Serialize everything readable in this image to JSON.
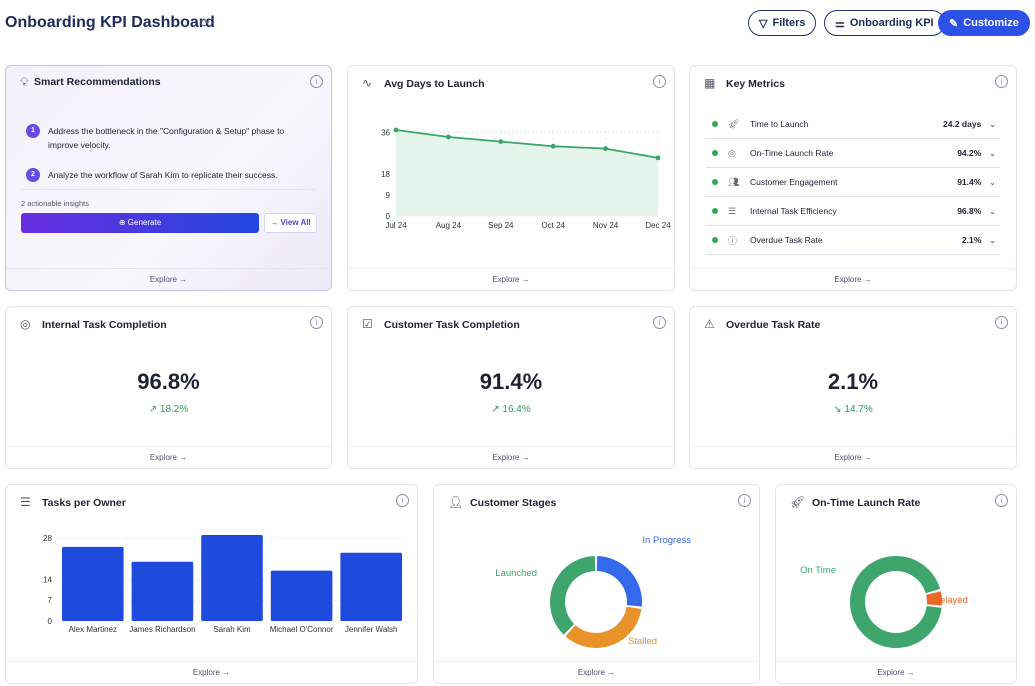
{
  "header": {
    "title": "Onboarding KPI Dashboard",
    "filters": "Filters",
    "kpi": "Onboarding KPI",
    "customize": "Customize"
  },
  "explore": "Explore →",
  "smart": {
    "title": "Smart Recommendations",
    "items": [
      {
        "n": "1",
        "text": "Address the bottleneck in the \"Configuration & Setup\" phase to improve velocity."
      },
      {
        "n": "2",
        "text": "Analyze the workflow of Sarah Kim to replicate their success."
      }
    ],
    "count": "2 actionable insights",
    "generate": "Generate",
    "view_all": "→ View All"
  },
  "avg": {
    "title": "Avg Days to Launch"
  },
  "key": {
    "title": "Key Metrics",
    "rows": [
      {
        "label": "Time to Launch",
        "value": "24.2 days"
      },
      {
        "label": "On-Time Launch Rate",
        "value": "94.2%"
      },
      {
        "label": "Customer Engagement",
        "value": "91.4%"
      },
      {
        "label": "Internal Task Efficiency",
        "value": "96.8%"
      },
      {
        "label": "Overdue Task Rate",
        "value": "2.1%"
      }
    ]
  },
  "kpis": [
    {
      "title": "Internal Task Completion",
      "value": "96.8%",
      "trend": "18.2%",
      "dir": "up"
    },
    {
      "title": "Customer Task Completion",
      "value": "91.4%",
      "trend": "16.4%",
      "dir": "up"
    },
    {
      "title": "Overdue Task Rate",
      "value": "2.1%",
      "trend": "14.7%",
      "dir": "down"
    }
  ],
  "tasks": {
    "title": "Tasks per Owner"
  },
  "stages": {
    "title": "Customer Stages"
  },
  "ontime": {
    "title": "On-Time Launch Rate"
  },
  "chart_data": [
    {
      "type": "line",
      "title": "Avg Days to Launch",
      "categories": [
        "Jul 24",
        "Aug 24",
        "Sep 24",
        "Oct 24",
        "Nov 24",
        "Dec 24"
      ],
      "values": [
        37,
        34,
        32,
        30,
        29,
        25
      ],
      "yticks": [
        0,
        9,
        18,
        36
      ],
      "ylim": [
        0,
        37
      ],
      "color": "#3aa56a"
    },
    {
      "type": "bar",
      "title": "Tasks per Owner",
      "categories": [
        "Alex Martinez",
        "James Richardson",
        "Sarah Kim",
        "Michael O'Connor",
        "Jennifer Walsh"
      ],
      "values": [
        25,
        20,
        29,
        17,
        23
      ],
      "yticks": [
        0,
        7,
        14,
        28
      ],
      "ylim": [
        0,
        29
      ],
      "color": "#1f4ade"
    },
    {
      "type": "pie",
      "title": "Customer Stages",
      "labels": [
        "In Progress",
        "Stalled",
        "Launched"
      ],
      "values": [
        27,
        35,
        38
      ],
      "colors": [
        "#3369ea",
        "#e8922a",
        "#3ea56d"
      ]
    },
    {
      "type": "pie",
      "title": "On-Time Launch Rate",
      "labels": [
        "Delayed",
        "On Time"
      ],
      "values": [
        5.8,
        94.2
      ],
      "colors": [
        "#e8692a",
        "#3ea56d"
      ]
    }
  ]
}
